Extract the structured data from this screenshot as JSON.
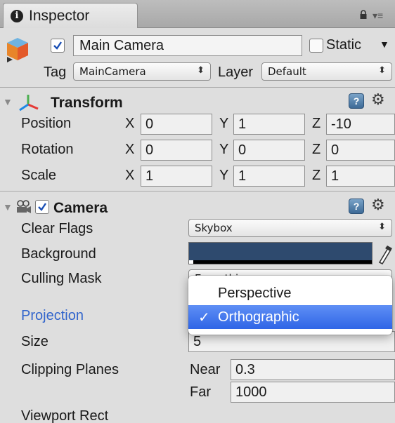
{
  "tab": {
    "title": "Inspector"
  },
  "object": {
    "name": "Main Camera",
    "active": true,
    "static_label": "Static",
    "static_checked": false,
    "tag_label": "Tag",
    "tag_value": "MainCamera",
    "layer_label": "Layer",
    "layer_value": "Default"
  },
  "transform": {
    "title": "Transform",
    "rows": [
      {
        "label": "Position",
        "x": "0",
        "y": "1",
        "z": "-10"
      },
      {
        "label": "Rotation",
        "x": "0",
        "y": "0",
        "z": "0"
      },
      {
        "label": "Scale",
        "x": "1",
        "y": "1",
        "z": "1"
      }
    ],
    "axis_x": "X",
    "axis_y": "Y",
    "axis_z": "Z"
  },
  "camera": {
    "title": "Camera",
    "enabled": true,
    "clear_flags_label": "Clear Flags",
    "clear_flags_value": "Skybox",
    "background_label": "Background",
    "background_color": "#2e4a6e",
    "culling_mask_label": "Culling Mask",
    "culling_mask_value": "Everything",
    "projection_label": "Projection",
    "size_label": "Size",
    "size_value": "5",
    "clipping_label": "Clipping Planes",
    "near_label": "Near",
    "near_value": "0.3",
    "far_label": "Far",
    "far_value": "1000",
    "viewport_label": "Viewport Rect"
  },
  "projection_menu": {
    "options": [
      "Perspective",
      "Orthographic"
    ],
    "selected": "Orthographic",
    "check_glyph": "✓"
  },
  "colors": {
    "selection": "#2f65e6",
    "projection_label": "#3366cc"
  }
}
